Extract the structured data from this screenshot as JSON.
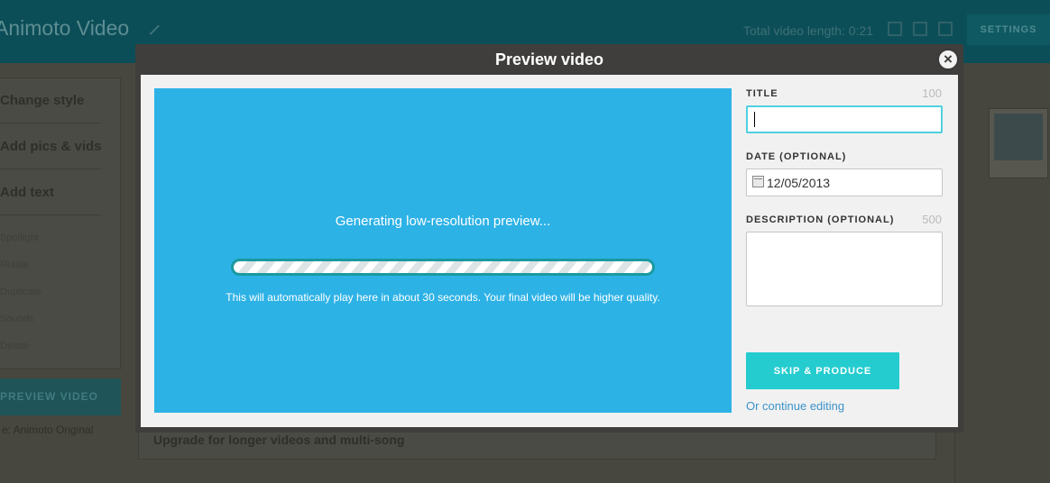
{
  "app": {
    "title": "Animoto Video",
    "video_length": "Total video length: 0:21",
    "settings_label": "SETTINGS"
  },
  "sidebar": {
    "items": [
      {
        "label": "Change style"
      },
      {
        "label": "Add pics & vids"
      },
      {
        "label": "Add text"
      }
    ],
    "subitems": [
      "Spotlight",
      "Rotate",
      "Duplicate",
      "Sounds",
      "Delete"
    ],
    "preview_label": "PREVIEW VIDEO",
    "style_line": "e: Animoto Original"
  },
  "upgrade": {
    "text": "Upgrade for longer videos and multi-song"
  },
  "modal": {
    "title": "Preview video",
    "close_label": "×",
    "generating_text": "Generating low-resolution preview...",
    "progress": 1.0,
    "info_text": "This will automatically play here in about 30 seconds. Your final video will be higher quality.",
    "title_field": {
      "label": "TITLE",
      "counter": "100",
      "value": ""
    },
    "date_field": {
      "label": "DATE (OPTIONAL)",
      "value": "12/05/2013"
    },
    "description_field": {
      "label": "DESCRIPTION (OPTIONAL)",
      "counter": "500",
      "value": ""
    },
    "skip_button": "SKIP & PRODUCE",
    "continue_link": "Or continue editing"
  },
  "icons": {
    "close": "close-icon",
    "calendar": "calendar-icon",
    "edit": "pencil-icon"
  },
  "colors": {
    "accent": "#24cccf",
    "preview_bg": "#2db2e6",
    "link": "#3a93c9"
  }
}
